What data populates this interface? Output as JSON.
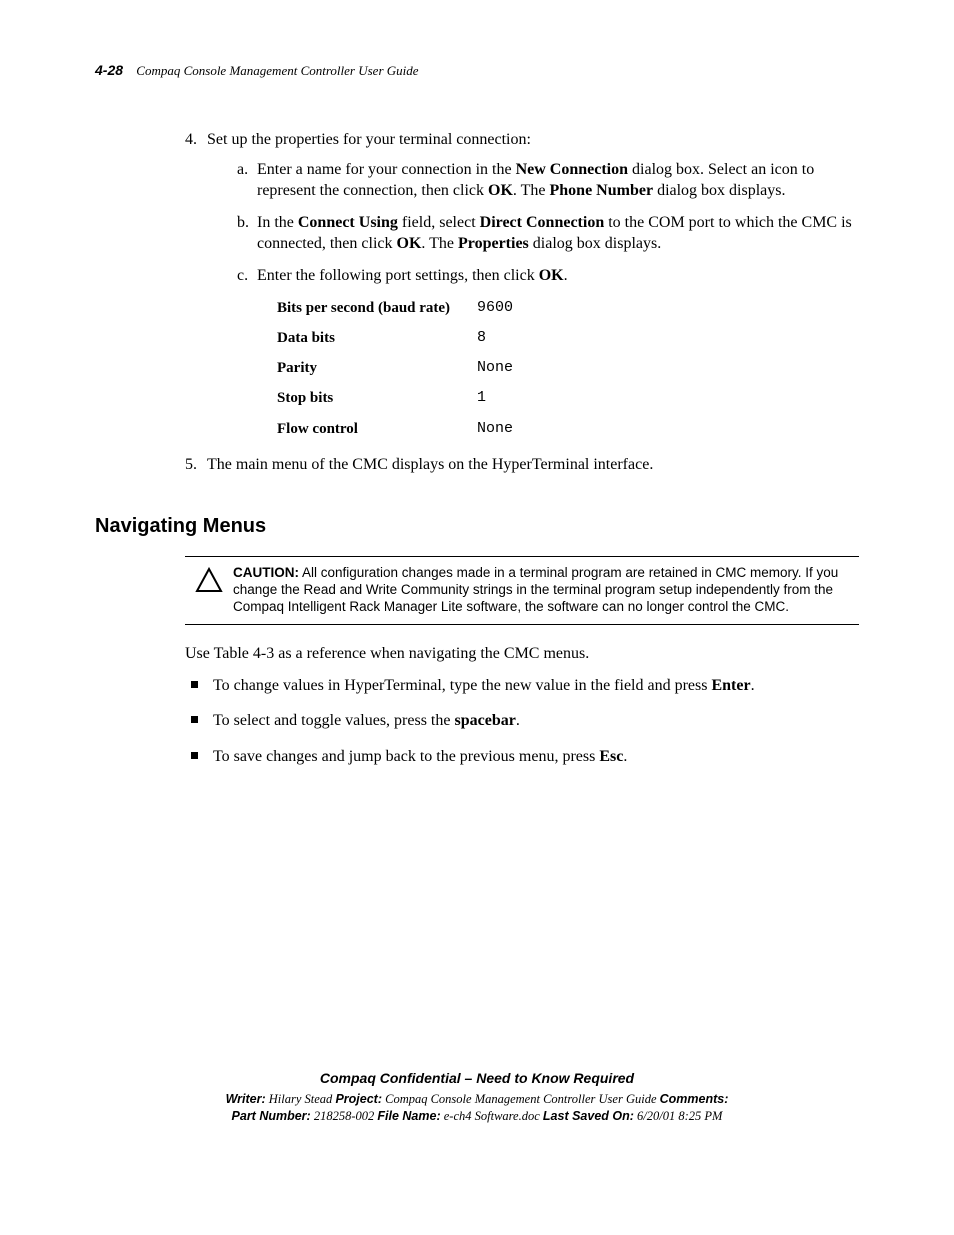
{
  "header": {
    "page_number": "4-28",
    "title": "Compaq Console Management Controller User Guide"
  },
  "step4": {
    "num": "4.",
    "text": "Set up the properties for your terminal connection:",
    "a": {
      "lbl": "a.",
      "pre": "Enter a name for your connection in the ",
      "bold1": "New Connection",
      "mid": " dialog box. Select an icon to represent the connection, then click ",
      "bold2": "OK",
      "post": ". The ",
      "bold3": "Phone Number",
      "end": " dialog box displays."
    },
    "b": {
      "lbl": "b.",
      "pre": "In the ",
      "bold1": "Connect Using",
      "mid1": " field, select ",
      "bold2": "Direct Connection",
      "mid2": " to the COM port to which the CMC is connected, then click ",
      "bold3": "OK",
      "mid3": ". The ",
      "bold4": "Properties",
      "end": " dialog box displays."
    },
    "c": {
      "lbl": "c.",
      "pre": "Enter the following port settings, then click ",
      "bold1": "OK",
      "end": "."
    },
    "settings": [
      {
        "k": "Bits per second (baud rate)",
        "v": "9600"
      },
      {
        "k": "Data bits",
        "v": "8"
      },
      {
        "k": "Parity",
        "v": "None"
      },
      {
        "k": "Stop bits",
        "v": "1"
      },
      {
        "k": "Flow control",
        "v": "None"
      }
    ]
  },
  "step5": {
    "num": "5.",
    "text": "The main menu of the CMC displays on the HyperTerminal interface."
  },
  "section_title": "Navigating Menus",
  "caution": {
    "label": "CAUTION:",
    "text": "  All configuration changes made in a terminal program are retained in CMC memory. If you change the Read and Write Community strings in the terminal program setup independently from the Compaq Intelligent Rack Manager Lite software, the software can no longer control the CMC."
  },
  "nav_intro": "Use Table 4-3 as a reference when navigating the CMC menus.",
  "bullets": {
    "b1": {
      "pre": "To change values in HyperTerminal, type the new value in the field and press ",
      "bold": "Enter",
      "end": "."
    },
    "b2": {
      "pre": "To select and toggle values, press the ",
      "bold": "spacebar",
      "end": "."
    },
    "b3": {
      "pre": "To save changes and jump back to the previous menu, press ",
      "bold": "Esc",
      "end": "."
    }
  },
  "footer": {
    "confidential": "Compaq Confidential – Need to Know Required",
    "writer_label": "Writer:",
    "writer": " Hilary Stead  ",
    "project_label": "Project:",
    "project": " Compaq Console Management Controller User Guide  ",
    "comments_label": "Comments:",
    "partnum_label": "Part Number:",
    "partnum": " 218258-002  ",
    "filename_label": "File Name:",
    "filename": " e-ch4 Software.doc  ",
    "lastsaved_label": "Last Saved On:",
    "lastsaved": " 6/20/01 8:25 PM"
  }
}
